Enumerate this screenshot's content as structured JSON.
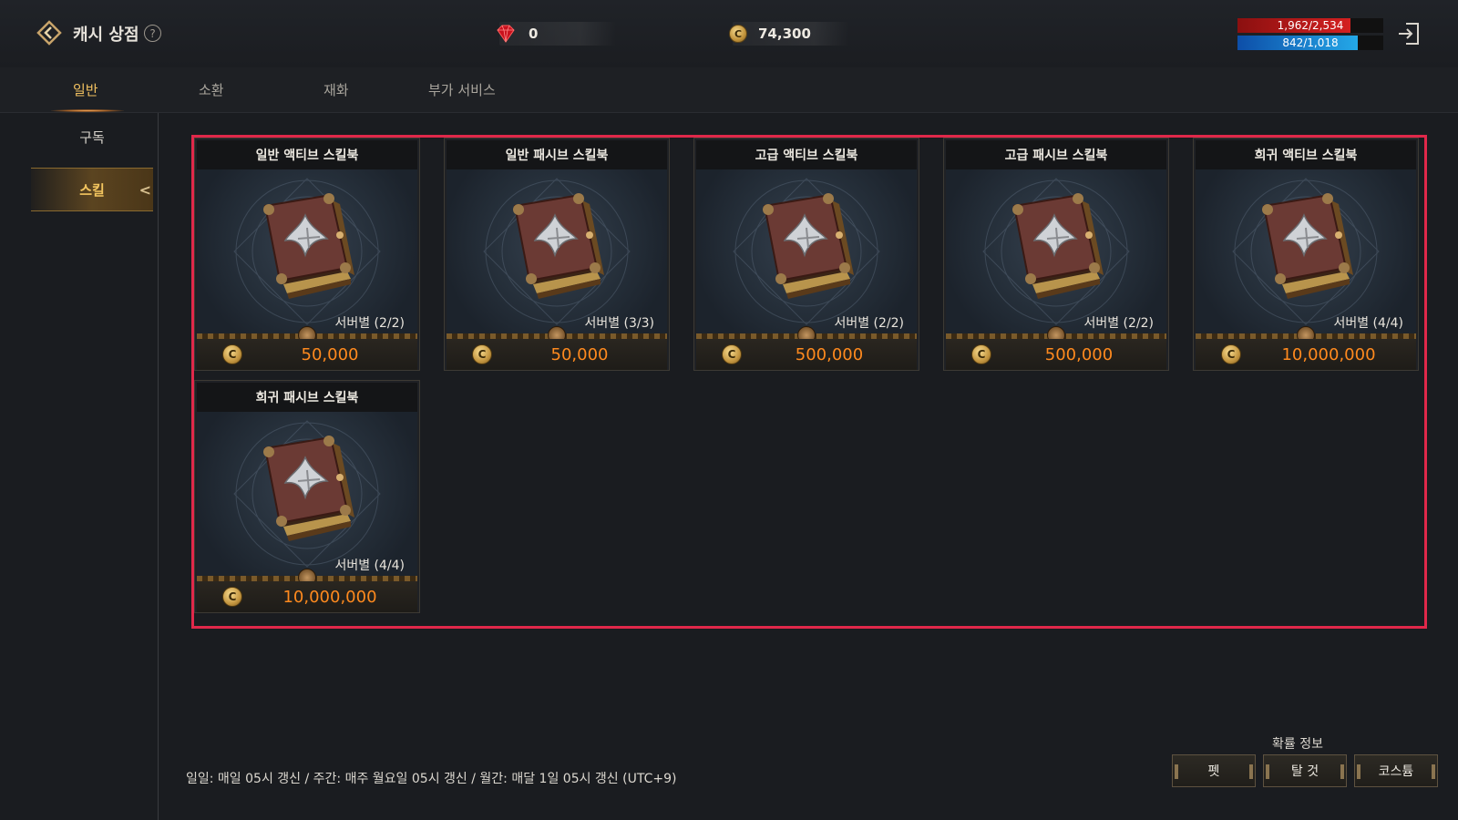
{
  "header": {
    "title": "캐시 상점",
    "help_glyph": "?",
    "gem_amount": "0",
    "gold_amount": "74,300",
    "hp_text": "1,962/2,534",
    "hp_fraction": 0.774,
    "mp_text": "842/1,018",
    "mp_fraction": 0.827
  },
  "tabs": [
    {
      "label": "일반",
      "active": true
    },
    {
      "label": "소환",
      "active": false
    },
    {
      "label": "재화",
      "active": false
    },
    {
      "label": "부가 서비스",
      "active": false
    }
  ],
  "sidebar": {
    "items": [
      {
        "label": "구독",
        "active": false
      },
      {
        "label": "스킬",
        "active": true
      }
    ]
  },
  "products": [
    {
      "title": "일반 액티브 스킬북",
      "limit": "서버별 (2/2)",
      "price": "50,000"
    },
    {
      "title": "일반 패시브 스킬북",
      "limit": "서버별 (3/3)",
      "price": "50,000"
    },
    {
      "title": "고급 액티브 스킬북",
      "limit": "서버별 (2/2)",
      "price": "500,000"
    },
    {
      "title": "고급 패시브 스킬북",
      "limit": "서버별 (2/2)",
      "price": "500,000"
    },
    {
      "title": "희귀 액티브 스킬북",
      "limit": "서버별 (4/4)",
      "price": "10,000,000"
    },
    {
      "title": "희귀 패시브 스킬북",
      "limit": "서버별 (4/4)",
      "price": "10,000,000"
    }
  ],
  "coin_glyph": "C",
  "footer": {
    "note": "일일: 매일 05시 갱신 / 주간: 매주 월요일 05시 갱신 / 월간: 매달 1일 05시 갱신 (UTC+9)",
    "prob_title": "확률 정보",
    "prob_buttons": [
      "펫",
      "탈 것",
      "코스튬"
    ]
  },
  "colors": {
    "accent_gold": "#f3c55f",
    "price_orange": "#ff8a1e",
    "highlight_border": "#e0284a",
    "hp_red": "#d42020",
    "mp_blue": "#24a8e8"
  },
  "icons": [
    "back-arrow-icon",
    "help-icon",
    "gem-icon",
    "gold-coin-icon",
    "exit-icon",
    "chevron-left-icon",
    "skill-book-icon"
  ]
}
